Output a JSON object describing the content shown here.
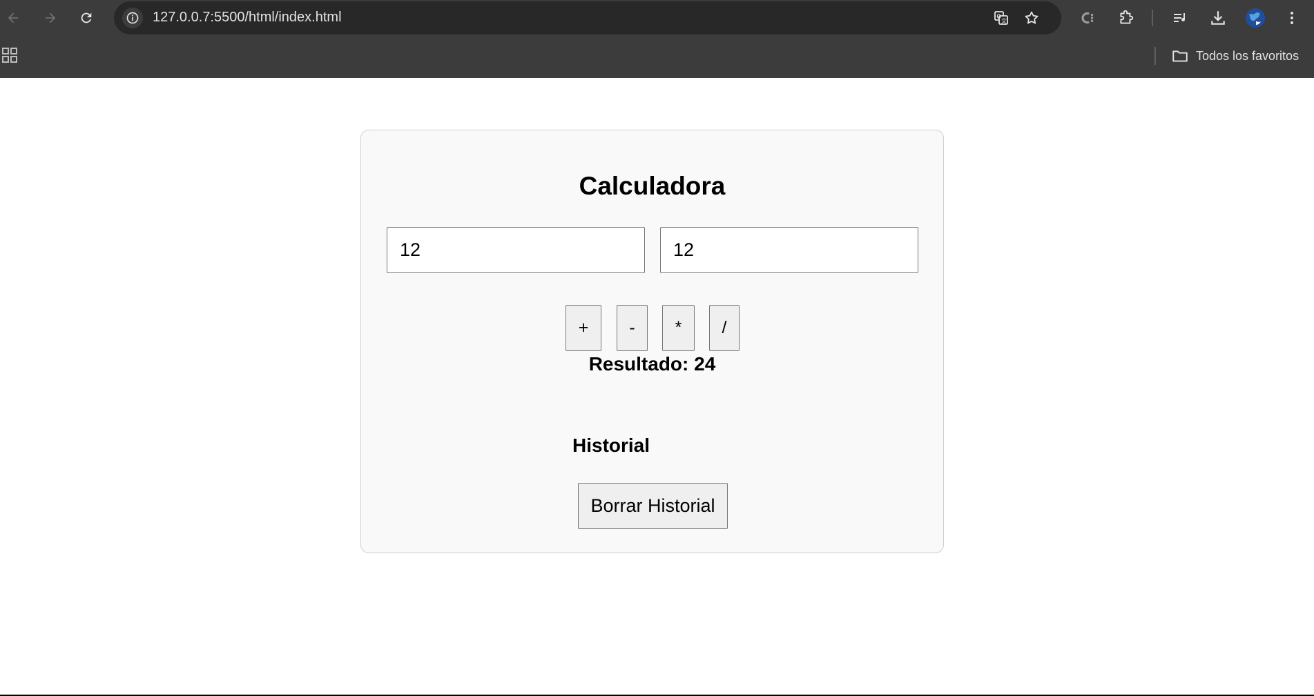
{
  "browser": {
    "url": "127.0.0.7:5500/html/index.html",
    "bookmarks_folder_label": "Todos los favoritos",
    "icons": {
      "back": "arrow-left-icon",
      "forward": "arrow-right-icon",
      "reload": "reload-icon",
      "site_info": "info-icon",
      "translate": "translate-icon",
      "bookmark_star": "star-icon",
      "extension_c": "extension-icon",
      "extensions": "puzzle-icon",
      "reading_list": "reading-list-icon",
      "downloads": "download-icon",
      "profile": "avatar-icon",
      "menu": "kebab-menu-icon",
      "apps": "apps-grid-icon",
      "folder": "folder-icon"
    },
    "colors": {
      "chrome_bg": "#3c3c3c",
      "omnibox_bg": "#282828",
      "chrome_text": "#e3e3e3"
    }
  },
  "calculator": {
    "title": "Calculadora",
    "input1_value": "12",
    "input2_value": "12",
    "operations": [
      "+",
      "-",
      "*",
      "/"
    ],
    "result_text": "Resultado: 24",
    "history_title": "Historial",
    "clear_history_label": "Borrar Historial",
    "colors": {
      "card_bg": "#f9f9f9",
      "card_border": "#d0d0d0",
      "button_bg": "#efefef"
    }
  }
}
